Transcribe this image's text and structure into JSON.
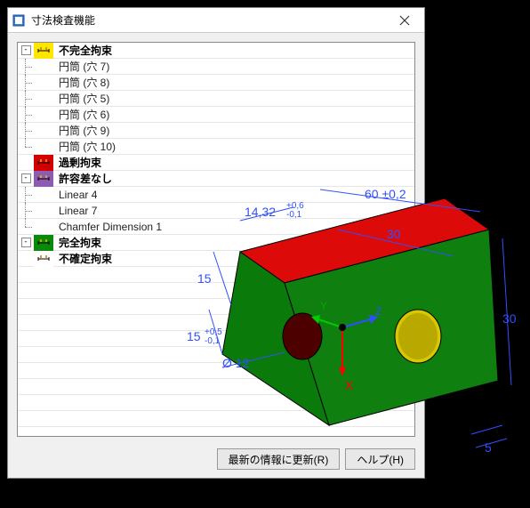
{
  "window": {
    "title": "寸法検査機能",
    "close_tooltip": "閉じる"
  },
  "tree": {
    "groups": [
      {
        "id": "underconstrained",
        "color": "yellow",
        "label": "不完全拘束",
        "expanded": true,
        "icon": "ruler-icon",
        "children": [
          {
            "label": "円筒 (穴 7)"
          },
          {
            "label": "円筒 (穴 8)"
          },
          {
            "label": "円筒 (穴 5)"
          },
          {
            "label": "円筒 (穴 6)"
          },
          {
            "label": "円筒 (穴 9)"
          },
          {
            "label": "円筒 (穴 10)"
          }
        ]
      },
      {
        "id": "overconstrained",
        "color": "red",
        "label": "過剰拘束",
        "expanded": false,
        "icon": "ruler-icon",
        "children": []
      },
      {
        "id": "notolerance",
        "color": "purple",
        "label": "許容差なし",
        "expanded": true,
        "icon": "ruler-icon",
        "children": [
          {
            "label": "Linear 4"
          },
          {
            "label": "Linear 7"
          },
          {
            "label": "Chamfer Dimension 1"
          }
        ]
      },
      {
        "id": "fullyconstrained",
        "color": "green",
        "label": "完全拘束",
        "expanded": false,
        "icon": "ruler-icon",
        "children": []
      },
      {
        "id": "indeterminate",
        "color": "white",
        "label": "不確定拘束",
        "expanded": false,
        "icon": "ruler-icon",
        "children": []
      }
    ]
  },
  "footer": {
    "refresh_label": "最新の情報に更新(R)",
    "help_label": "ヘルプ(H)"
  },
  "model": {
    "dims": {
      "d1": "14,32",
      "d1tol_upper": "+0,6",
      "d1tol_lower": "-0,1",
      "d2": "60 ±0,2",
      "d3": "30",
      "d4": "15",
      "d5": "15",
      "d5tol_upper": "+0,5",
      "d5tol_lower": "-0,1",
      "d6": "Ø 12",
      "d7": "30",
      "d8": "5",
      "axes": {
        "x": "X",
        "y": "Y",
        "z": "Z"
      }
    }
  },
  "icons": {
    "expand": "+",
    "collapse": "-"
  }
}
